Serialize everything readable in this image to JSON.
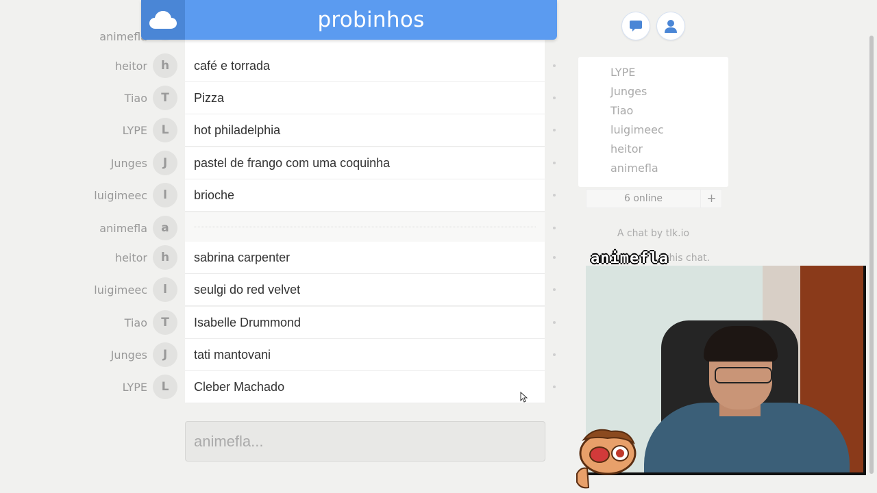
{
  "header": {
    "room_title": "probinhos",
    "logo_icon": "cloud-icon",
    "color": "#5b9bf0"
  },
  "chat": {
    "partial_top_user": "animefla",
    "messages": [
      {
        "user": "heitor",
        "initial": "h",
        "text": "café e torrada"
      },
      {
        "user": "Tiao",
        "initial": "T",
        "text": "Pizza"
      },
      {
        "user": "LYPE",
        "initial": "L",
        "text": "hot philadelphia"
      },
      {
        "user": "Junges",
        "initial": "J",
        "text": "pastel de frango com uma coquinha"
      },
      {
        "user": "luigimeec",
        "initial": "l",
        "text": "brioche"
      },
      {
        "user": "animefla",
        "initial": "a",
        "text": ""
      },
      {
        "user": "heitor",
        "initial": "h",
        "text": "sabrina carpenter"
      },
      {
        "user": "luigimeec",
        "initial": "l",
        "text": "seulgi do red velvet"
      },
      {
        "user": "Tiao",
        "initial": "T",
        "text": "Isabelle Drummond"
      },
      {
        "user": "Junges",
        "initial": "J",
        "text": "tati mantovani"
      },
      {
        "user": "LYPE",
        "initial": "L",
        "text": "Cleber Machado"
      }
    ],
    "compose_placeholder": "animefla..."
  },
  "sidebar": {
    "chat_button_icon": "chat-bubble-icon",
    "profile_button_icon": "user-icon",
    "users": [
      "LYPE",
      "Junges",
      "Tiao",
      "luigimeec",
      "heitor",
      "animefla"
    ],
    "online_count": "6 online",
    "add_label": "+",
    "credit": "A chat by tlk.io",
    "credit_partial": "this chat."
  },
  "overlay": {
    "watermark": "animefla"
  }
}
